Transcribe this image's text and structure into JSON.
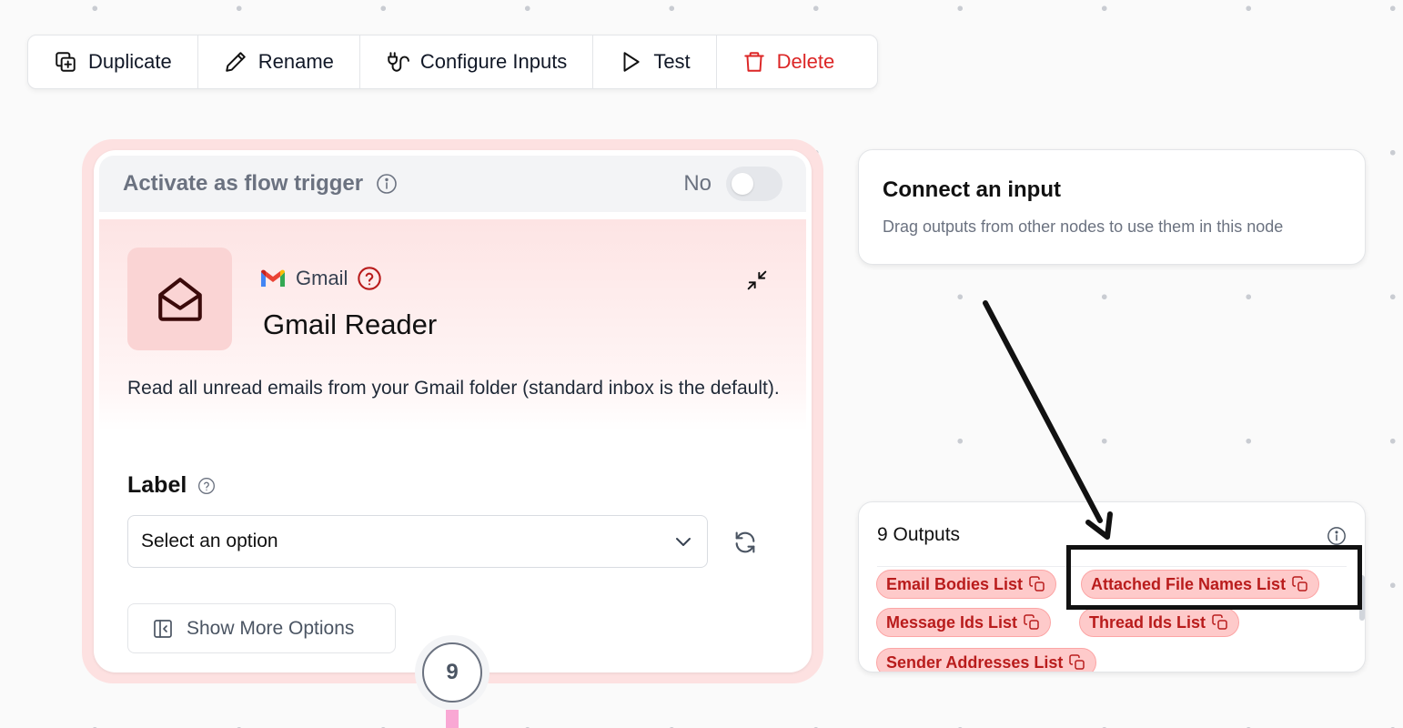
{
  "toolbar": {
    "duplicate": "Duplicate",
    "rename": "Rename",
    "configure_inputs": "Configure Inputs",
    "test": "Test",
    "delete": "Delete"
  },
  "node": {
    "trigger_label": "Activate as flow trigger",
    "trigger_state": "No",
    "trigger_enabled": false,
    "provider": "Gmail",
    "title": "Gmail Reader",
    "description": "Read all unread emails from your Gmail folder (standard inbox is the default).",
    "field_label": "Label",
    "select_placeholder": "Select an option",
    "more_options": "Show More Options",
    "output_count": "9"
  },
  "connect": {
    "title": "Connect an input",
    "subtitle": "Drag outputs from other nodes to use them in this node"
  },
  "outputs": {
    "title": "9 Outputs",
    "chips": [
      "Email Bodies List",
      "Attached File Names List",
      "Message Ids List",
      "Thread Ids List",
      "Sender Addresses List"
    ]
  },
  "colors": {
    "accent_red": "#dc2626",
    "chip_bg": "#fecaca",
    "chip_text": "#b91c1c",
    "node_border": "#fde1e1"
  }
}
